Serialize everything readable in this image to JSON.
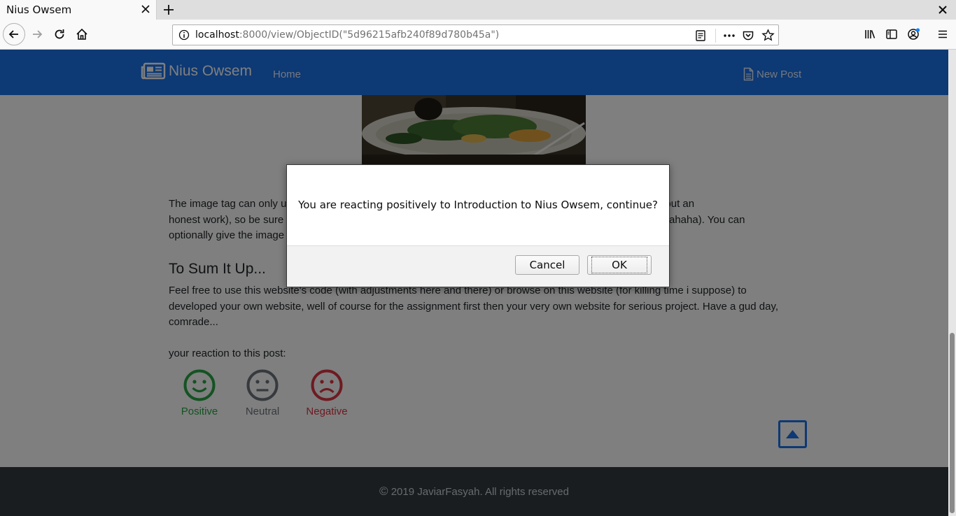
{
  "browser": {
    "tab_title": "Nius Owsem",
    "url_host": "localhost",
    "url_rest": ":8000/view/ObjectID(\"5d96215afb240f89d780b45a\")"
  },
  "site": {
    "brand": "Nius Owsem",
    "nav_home": "Home",
    "new_post": "New Post",
    "brand_color": "#1a73e8"
  },
  "article": {
    "para_image": "The image tag can only us... , it ain't much but an honest work), so be sure t... ahaha). You can optionally give the image a...",
    "para_image_left_1": "The image tag can only us",
    "para_image_right_1": "n, it ain't much but an",
    "para_image_left_2": "honest work), so be sure t",
    "para_image_right_2": "ahaha). You can",
    "para_image_left_3": "optionally give the image a",
    "heading": "To Sum It Up...",
    "para_sum": "Feel free to use this website's code (with adjustments here and there) or browse on this website (for killing time i suppose) to developed your own website, well of course for the assignment first then your very own website for serious project. Have a gud day, comrade..."
  },
  "reactions": {
    "prompt": "your reaction to this post:",
    "positive": "Positive",
    "neutral": "Neutral",
    "negative": "Negative",
    "colors": {
      "positive": "#28a745",
      "neutral": "#6c757d",
      "negative": "#dc3545"
    }
  },
  "footer": {
    "copyright_symbol": "©",
    "copyright_text": "2019 JaviarFasyah. All rights reserved"
  },
  "dialog": {
    "message": "You are reacting positively to Introduction to Nius Owsem, continue?",
    "cancel": "Cancel",
    "ok": "OK"
  },
  "icons": [
    "close-icon",
    "plus-icon",
    "back-arrow-icon",
    "forward-arrow-icon",
    "reload-icon",
    "home-icon",
    "info-icon",
    "reader-view-icon",
    "more-icon",
    "pocket-icon",
    "bookmark-star-icon",
    "library-icon",
    "sidebar-icon",
    "account-icon",
    "hamburger-menu-icon",
    "newspaper-icon",
    "document-icon",
    "smile-icon",
    "meh-icon",
    "frown-icon",
    "caret-up-icon"
  ]
}
